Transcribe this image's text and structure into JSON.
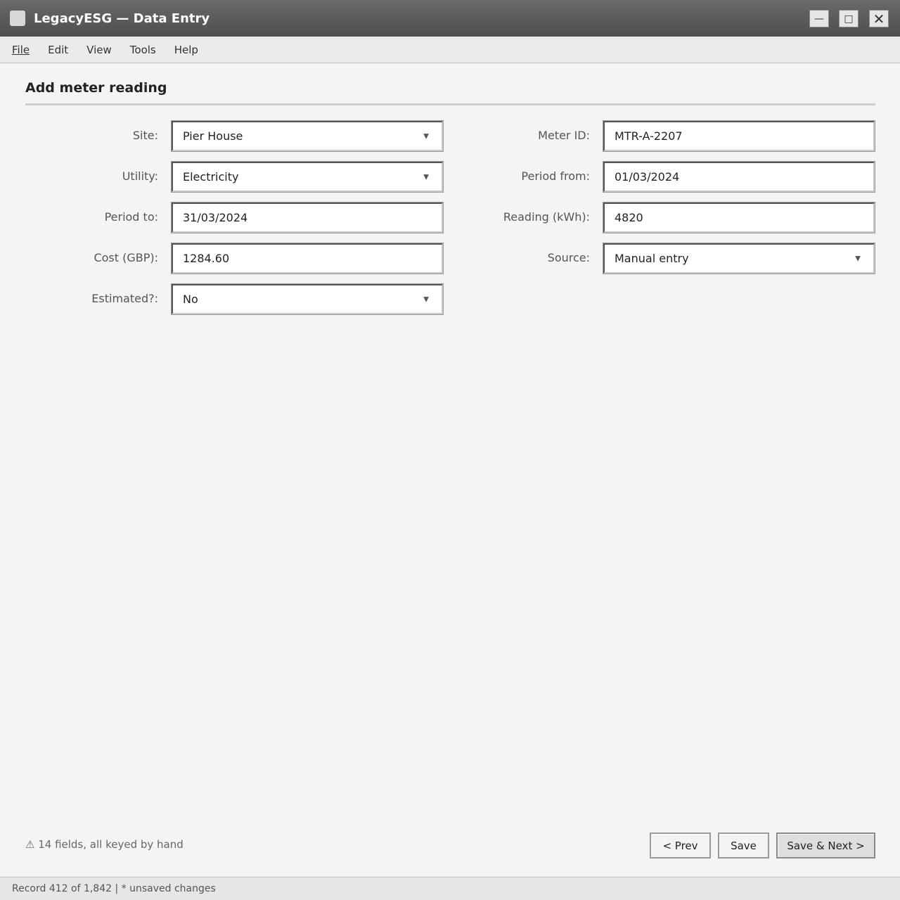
{
  "window": {
    "title": "LegacyESG — Data Entry",
    "icons": {
      "minimize": "—",
      "maximize": "□",
      "close": "✕"
    }
  },
  "menu": [
    "File",
    "Edit",
    "View",
    "Tools",
    "Help"
  ],
  "form": {
    "heading": "Add meter reading",
    "fields": {
      "site": {
        "label": "Site:",
        "value": "Pier House",
        "type": "select"
      },
      "utility": {
        "label": "Utility:",
        "value": "Electricity",
        "type": "select"
      },
      "period_to": {
        "label": "Period to:",
        "value": "31/03/2024",
        "type": "text"
      },
      "cost": {
        "label": "Cost (GBP):",
        "value": "1284.60",
        "type": "text"
      },
      "estimated": {
        "label": "Estimated?:",
        "value": "No",
        "type": "select"
      },
      "meter_id": {
        "label": "Meter ID:",
        "value": "MTR-A-2207",
        "type": "text"
      },
      "period_from": {
        "label": "Period from:",
        "value": "01/03/2024",
        "type": "text"
      },
      "reading": {
        "label": "Reading (kWh):",
        "value": "4820",
        "type": "text"
      },
      "source": {
        "label": "Source:",
        "value": "Manual entry",
        "type": "select"
      }
    },
    "dropdown_glyph": "▼"
  },
  "footer": {
    "hint": "⚠ 14 fields, all keyed by hand",
    "buttons": {
      "prev": "< Prev",
      "save": "Save",
      "save_next": "Save & Next >"
    }
  },
  "status": {
    "text": "Record 412 of 1,842 | * unsaved changes"
  },
  "colors": {
    "titlebar": "#5a5a5a",
    "background": "#f4f4f4",
    "accent": "#dedede"
  }
}
